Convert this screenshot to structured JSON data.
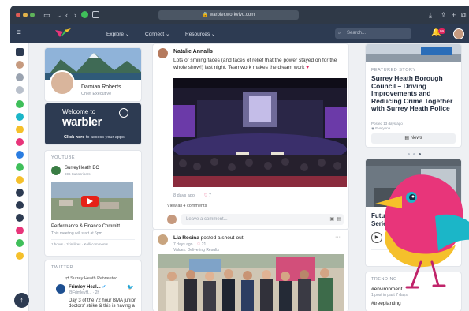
{
  "browser": {
    "url": "warbler.workvivo.com",
    "lock_icon": "lock-icon"
  },
  "header": {
    "nav": [
      "Explore",
      "Connect",
      "Resources"
    ],
    "search_placeholder": "Search...",
    "notification_count": "99"
  },
  "profile": {
    "name": "Damian Roberts",
    "role": "Chief Executive"
  },
  "welcome": {
    "line1": "Welcome to",
    "brand": "warbler",
    "cta_bold": "Click here",
    "cta_rest": " to access your apps."
  },
  "youtube": {
    "heading": "YOUTUBE",
    "channel": "SurreyHeath BC",
    "subscribers": "696 Subscribers",
    "video_title": "Performance & Finance Committ...",
    "video_note": "This meeting will start at 6pm",
    "video_meta": "1 hours · 1kin likes · Kelli comments"
  },
  "twitter": {
    "heading": "TWITTER",
    "retweet_label": "Surrey Heath Retweeted",
    "account": "Frimley Heal...",
    "handle": "@FrimleyH...",
    "age": "2h",
    "text": "Day 3 of the 72 hour BMA junior doctors' strike & this is having a"
  },
  "post1": {
    "author": "Natalie Annalls",
    "text": "Lots of smiling faces (and faces of relief that the power stayed on for the whole show!) last night. Teamwork makes the dream work",
    "age": "8 days ago",
    "likes": "7",
    "view_comments": "View all 4 comments",
    "comment_placeholder": "Leave a comment..."
  },
  "post2": {
    "author": "Lia Rosina",
    "action": " posted a shout-out.",
    "age": "7 days ago",
    "likes": "21",
    "value": "Values: Delivering Results"
  },
  "featured": {
    "label": "FEATURED STORY",
    "title": "Surrey Heath Borough Council – Driving Improvements and Reducing Crime Together with Surrey Heath Police",
    "date": "Posted 13 days ago",
    "audience": "Everyone",
    "button": "News"
  },
  "podcast": {
    "title": "Future Work Hub Podcast Series"
  },
  "trending": {
    "heading": "TRENDING",
    "tags": [
      {
        "tag": "#environment",
        "meta": "1 post in past 7 days"
      },
      {
        "tag": "#treeplanting",
        "meta": ""
      }
    ]
  },
  "colors": {
    "header": "#2d3b52",
    "accent": "#e0245e",
    "brand_pink": "#e8357a",
    "brand_yellow": "#f5c02b",
    "brand_teal": "#1bb6c8"
  }
}
